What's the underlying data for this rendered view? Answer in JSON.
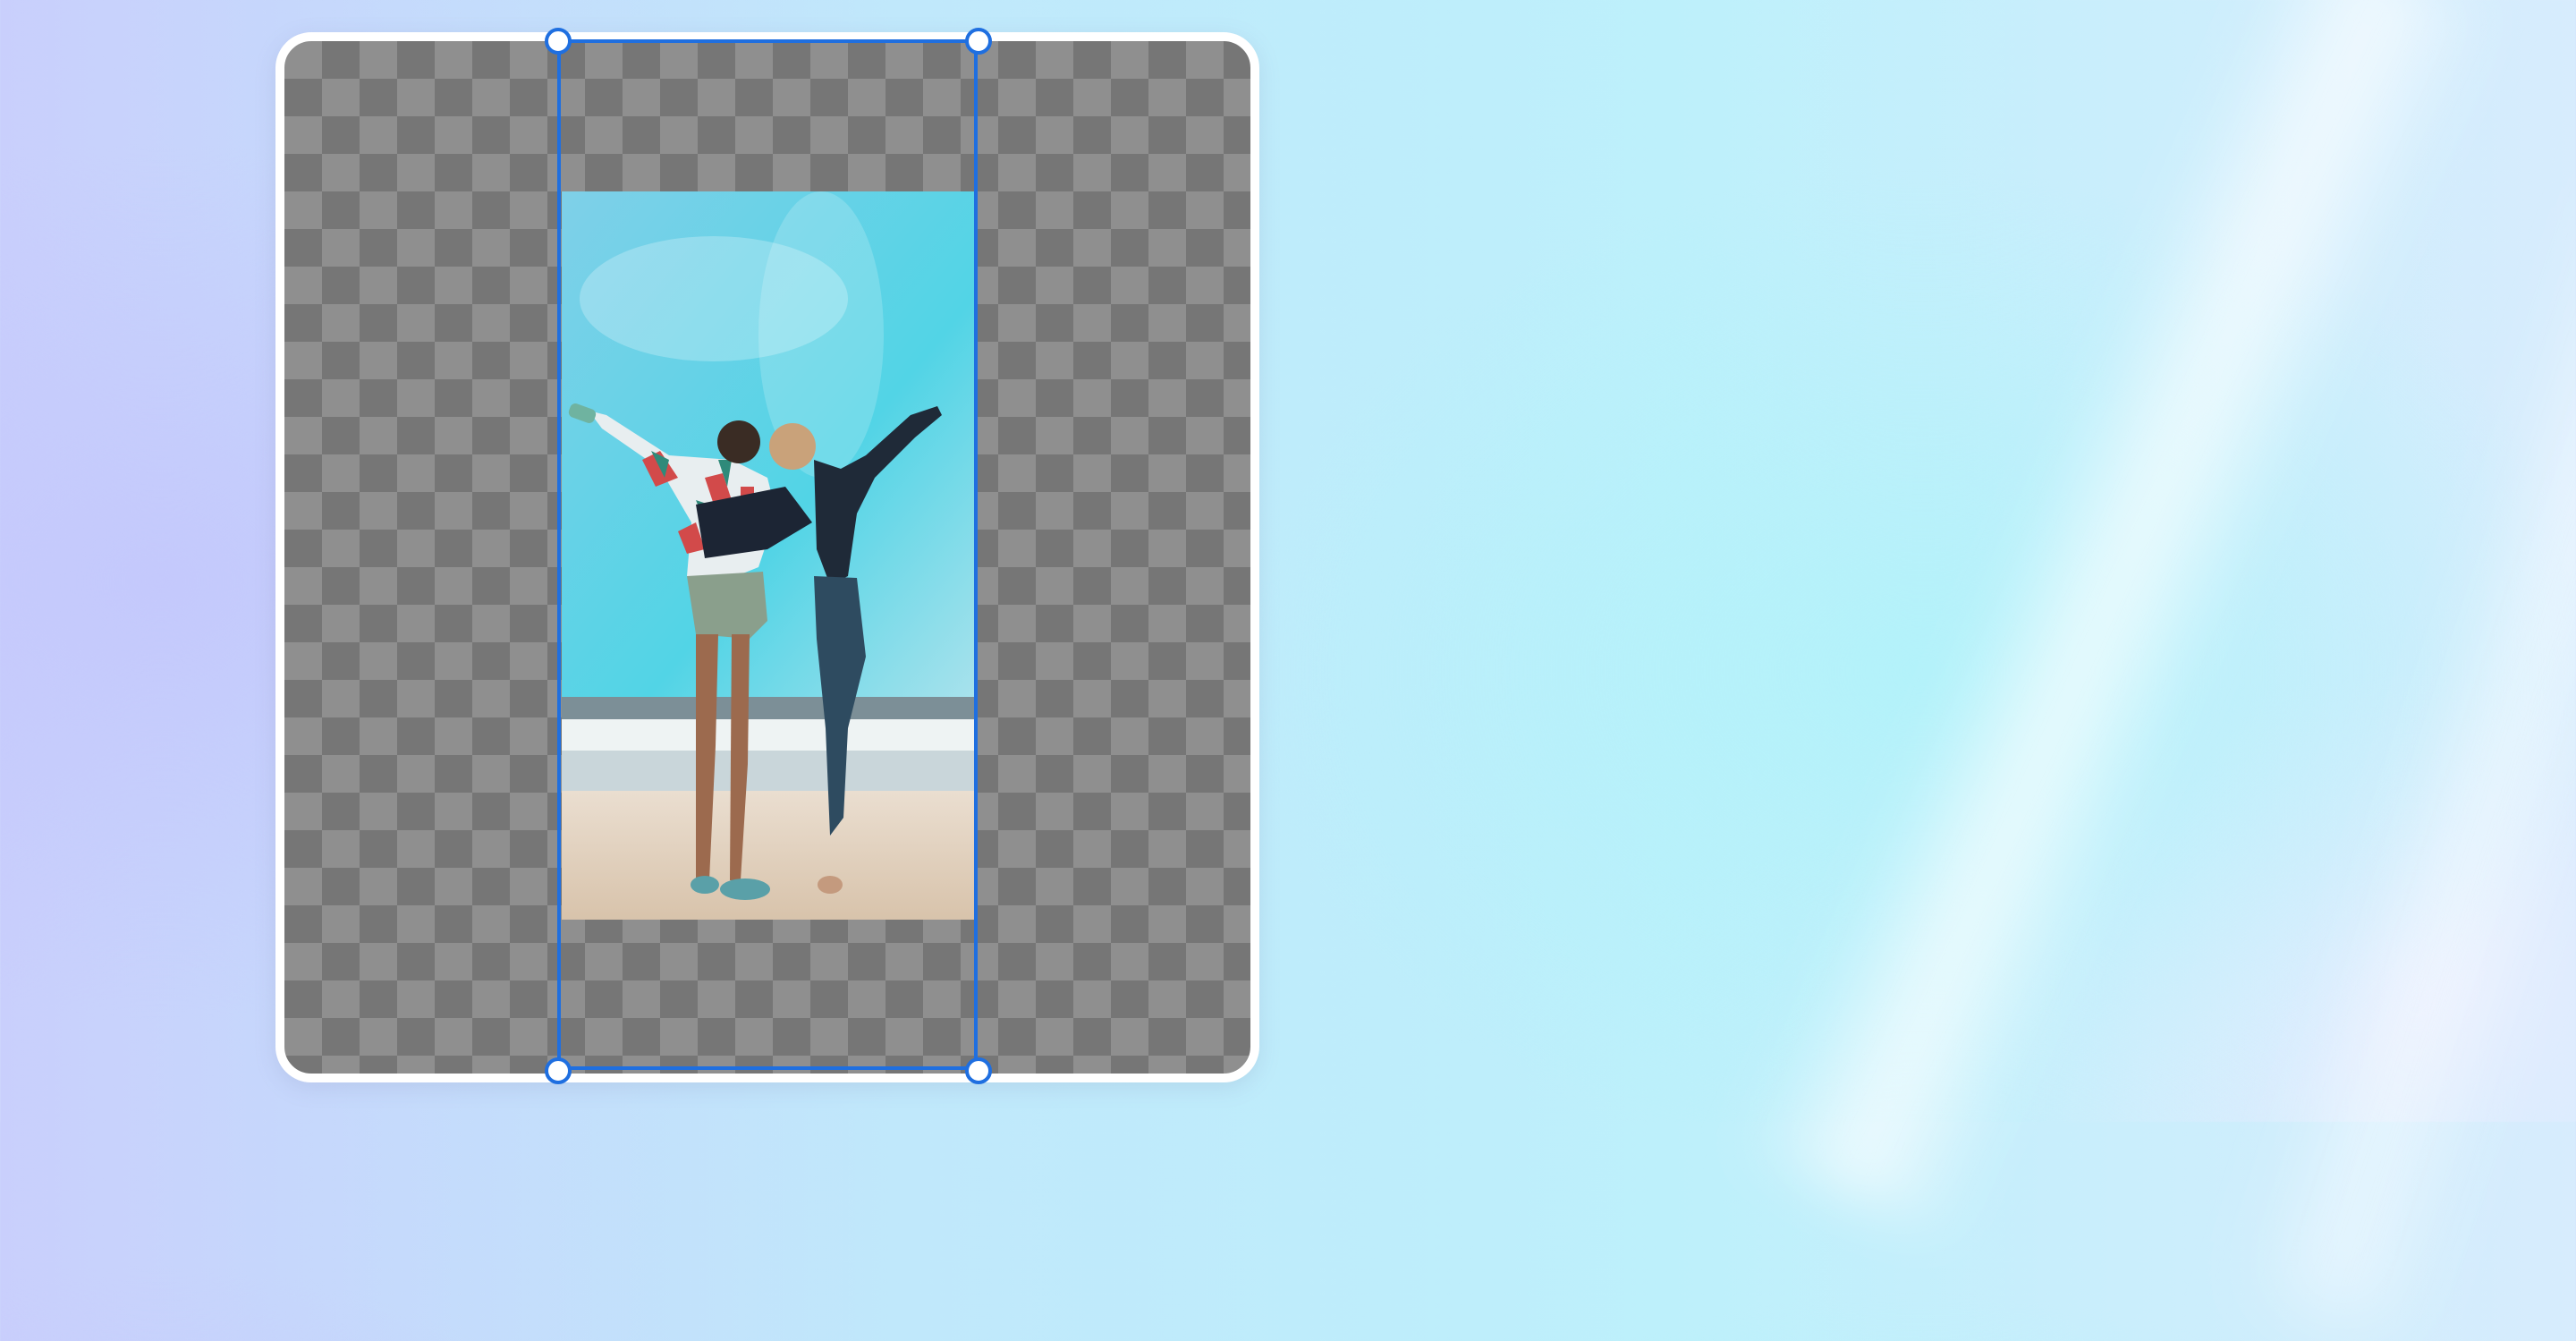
{
  "canvas": {
    "background": "transparent-checkerboard",
    "checker_colors": [
      "#8f8f8f",
      "#767676"
    ],
    "frame_color": "#ffffff"
  },
  "image_layer": {
    "description_icon": "beach-photo",
    "state": "selected"
  },
  "selection": {
    "stroke_color": "#1f6fe0",
    "handles": [
      "top-left",
      "top-right",
      "bottom-left",
      "bottom-right"
    ]
  },
  "background": {
    "colors": [
      "#c9cffc",
      "#bdf0fb",
      "#d7ecfd"
    ]
  }
}
